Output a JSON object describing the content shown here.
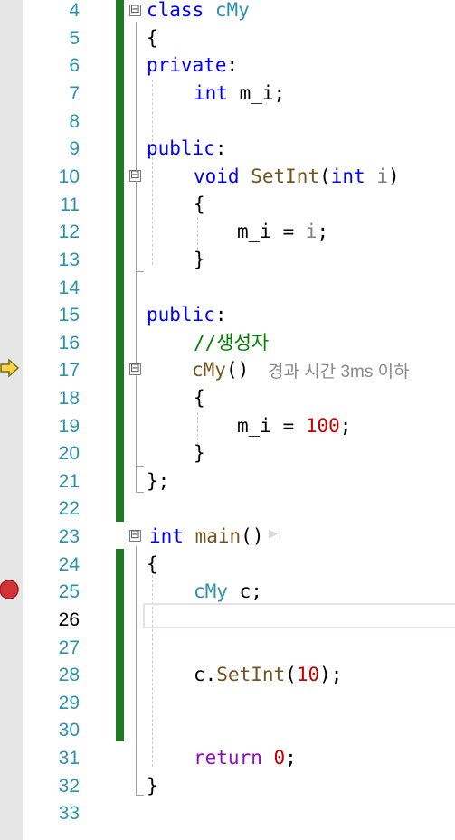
{
  "colors": {
    "keyword": "#0000ff",
    "type": "#2b91af",
    "function": "#74531f",
    "number": "#c80000",
    "parameter": "#808080",
    "comment": "#008000",
    "control_keyword": "#8f08c4",
    "change_bar": "#1f7a1f",
    "line_number": "#2b91af",
    "current_line_number": "#000000",
    "breakpoint": "#d13438",
    "execution_arrow": "#f5d547"
  },
  "editor": {
    "current_line": "26",
    "line_numbers": [
      "4",
      "5",
      "6",
      "7",
      "8",
      "9",
      "10",
      "11",
      "12",
      "13",
      "14",
      "15",
      "16",
      "17",
      "18",
      "19",
      "20",
      "21",
      "22",
      "23",
      "24",
      "25",
      "26",
      "27",
      "28",
      "29",
      "30",
      "31",
      "32",
      "33"
    ],
    "code": {
      "l4": {
        "kw": "class",
        "name": "cMy"
      },
      "l5": "{",
      "l6": {
        "kw": "private",
        "colon": ":"
      },
      "l7": {
        "type": "int",
        "rest": "m_i;"
      },
      "l9": {
        "kw": "public",
        "colon": ":"
      },
      "l10": {
        "type": "void",
        "fn": "SetInt",
        "open": "(",
        "ptype": "int",
        "param": "i",
        "close": ")"
      },
      "l11": "{",
      "l12": {
        "lhs": "m_i = ",
        "param": "i",
        "end": ";"
      },
      "l13": "}",
      "l15": {
        "kw": "public",
        "colon": ":"
      },
      "l16": "//생성자",
      "l17": {
        "name": "cMy",
        "parens": "()"
      },
      "l18": "{",
      "l19": {
        "lhs": "m_i = ",
        "num": "100",
        "end": ";"
      },
      "l20": "}",
      "l21": "};",
      "l23": {
        "type": "int",
        "fn": "main",
        "parens": "()"
      },
      "l24": "{",
      "l25": {
        "type": "cMy",
        "rest": " c;"
      },
      "l28": {
        "obj": "c.",
        "fn": "SetInt",
        "open": "(",
        "num": "10",
        "close": ");"
      },
      "l31": {
        "kw": "return",
        "num": "0",
        "end": ";"
      },
      "l32": "}"
    },
    "perf_tip": "경과 시간 3ms 이하",
    "run_to_here_icon": "run-to-click-icon",
    "gutter_icons": [
      "execution-arrow-icon",
      "breakpoint-icon"
    ],
    "fold_glyph": "⊟"
  }
}
